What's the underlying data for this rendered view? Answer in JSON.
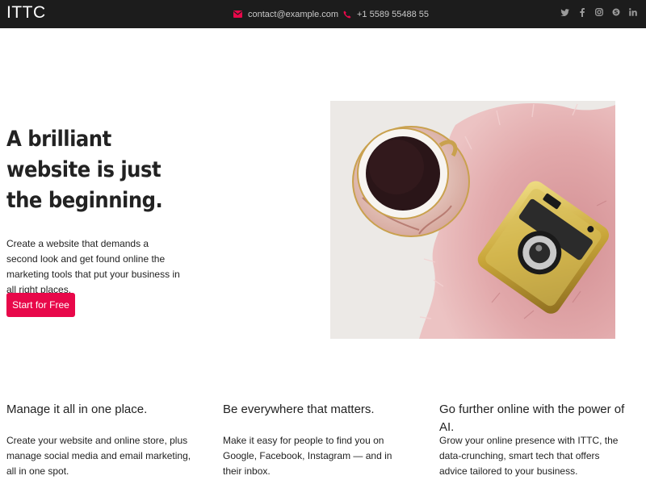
{
  "header": {
    "brand": "ITTC",
    "email": "contact@example.com",
    "phone": "+1 5589 55488 55",
    "email_icon": "envelope-icon",
    "phone_icon": "phone-icon",
    "social": [
      {
        "icon": "twitter-icon",
        "glyph": "𝕥"
      },
      {
        "icon": "facebook-icon",
        "glyph": "f"
      },
      {
        "icon": "instagram-icon",
        "glyph": ""
      },
      {
        "icon": "skype-icon",
        "glyph": "S"
      },
      {
        "icon": "linkedin-icon",
        "glyph": "in"
      }
    ]
  },
  "hero": {
    "title_lines": [
      "A brilliant",
      "website is just",
      "the beginning."
    ],
    "description": "Create a website that demands a second look and get found online the marketing tools that put your business in all right places.",
    "cta_label": "Start for Free",
    "image_icon": "coffee-and-camera-photo"
  },
  "features": [
    {
      "title": "Manage it all in one place.",
      "text": "Create your website and online store, plus manage social media and email marketing, all in one spot."
    },
    {
      "title": "Be everywhere that matters.",
      "text": "Make it easy for people to find you on Google, Facebook, Instagram — and in their inbox."
    },
    {
      "title": "Go further online with the power of AI.",
      "text": "Grow your online presence with ITTC, the data-crunching, smart tech that offers advice tailored to your business."
    }
  ],
  "colors": {
    "topbar": "#1c1c1c",
    "accent": "#e8084a"
  }
}
